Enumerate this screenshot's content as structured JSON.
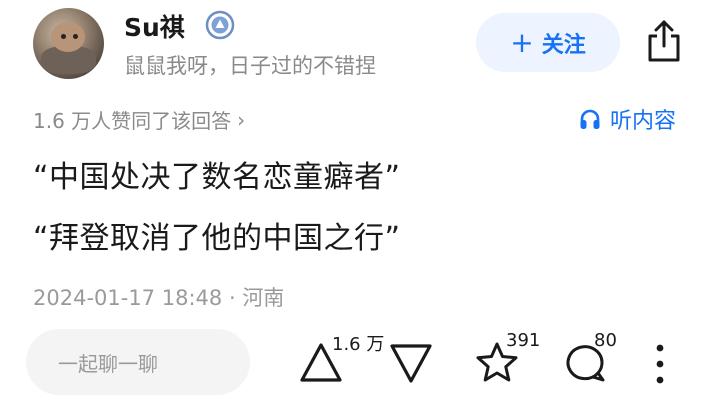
{
  "author": {
    "name": "Su祺",
    "bio": "鼠鼠我呀，日子过的不错捏"
  },
  "follow_button": {
    "plus": "+",
    "label": "关注"
  },
  "upvote_summary": {
    "text": "1.6 万人赞同了该回答",
    "chevron": "›"
  },
  "listen": {
    "label": "听内容"
  },
  "content": {
    "lines": [
      "“中国处决了数名恋童癖者”",
      "“拜登取消了他的中国之行”"
    ]
  },
  "meta": {
    "date": "2024-01-17 18:48",
    "separator": "·",
    "location": "河南"
  },
  "actions": {
    "comment_placeholder": "一起聊一聊",
    "upvote_count": "1.6 万",
    "star_count": "391",
    "comment_count": "80"
  },
  "colors": {
    "accent": "#1772f6",
    "follow_bg": "#edf3ff",
    "muted": "#8a8a8a"
  },
  "icons": [
    "verified-badge-icon",
    "share-icon",
    "headphone-icon",
    "upvote-icon",
    "downvote-icon",
    "star-icon",
    "comment-icon",
    "more-icon"
  ]
}
